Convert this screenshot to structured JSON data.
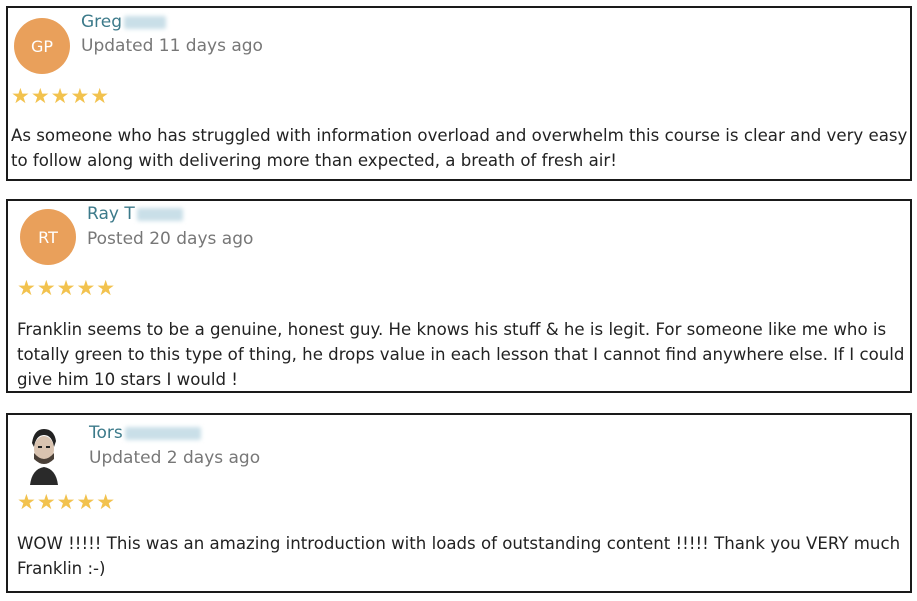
{
  "reviews": [
    {
      "avatar_initials": "GP",
      "avatar_color": "#e9a05b",
      "name_visible": "Greg",
      "meta": "Updated 11 days ago",
      "stars": "★★★★★",
      "rating": 5,
      "text": "As someone who has struggled with information overload and overwhelm this course is clear and very easy to follow along with delivering more than expected, a breath of fresh air!"
    },
    {
      "avatar_initials": "RT",
      "avatar_color": "#e9a05b",
      "name_visible": "Ray T",
      "meta": "Posted 20 days ago",
      "stars": "★★★★★",
      "rating": 5,
      "text": "Franklin seems to be a genuine, honest guy. He knows his stuff & he is legit. For someone like me who is totally green to this type of thing, he drops value in each lesson that I cannot find anywhere else. If I could give him 10 stars I would !"
    },
    {
      "avatar_type": "photo",
      "name_visible": "Tors",
      "meta": "Updated 2 days ago",
      "stars": "★★★★★",
      "rating": 5,
      "text": "WOW !!!!! This was an amazing introduction with loads of outstanding content !!!!! Thank you VERY much Franklin :-)"
    }
  ]
}
